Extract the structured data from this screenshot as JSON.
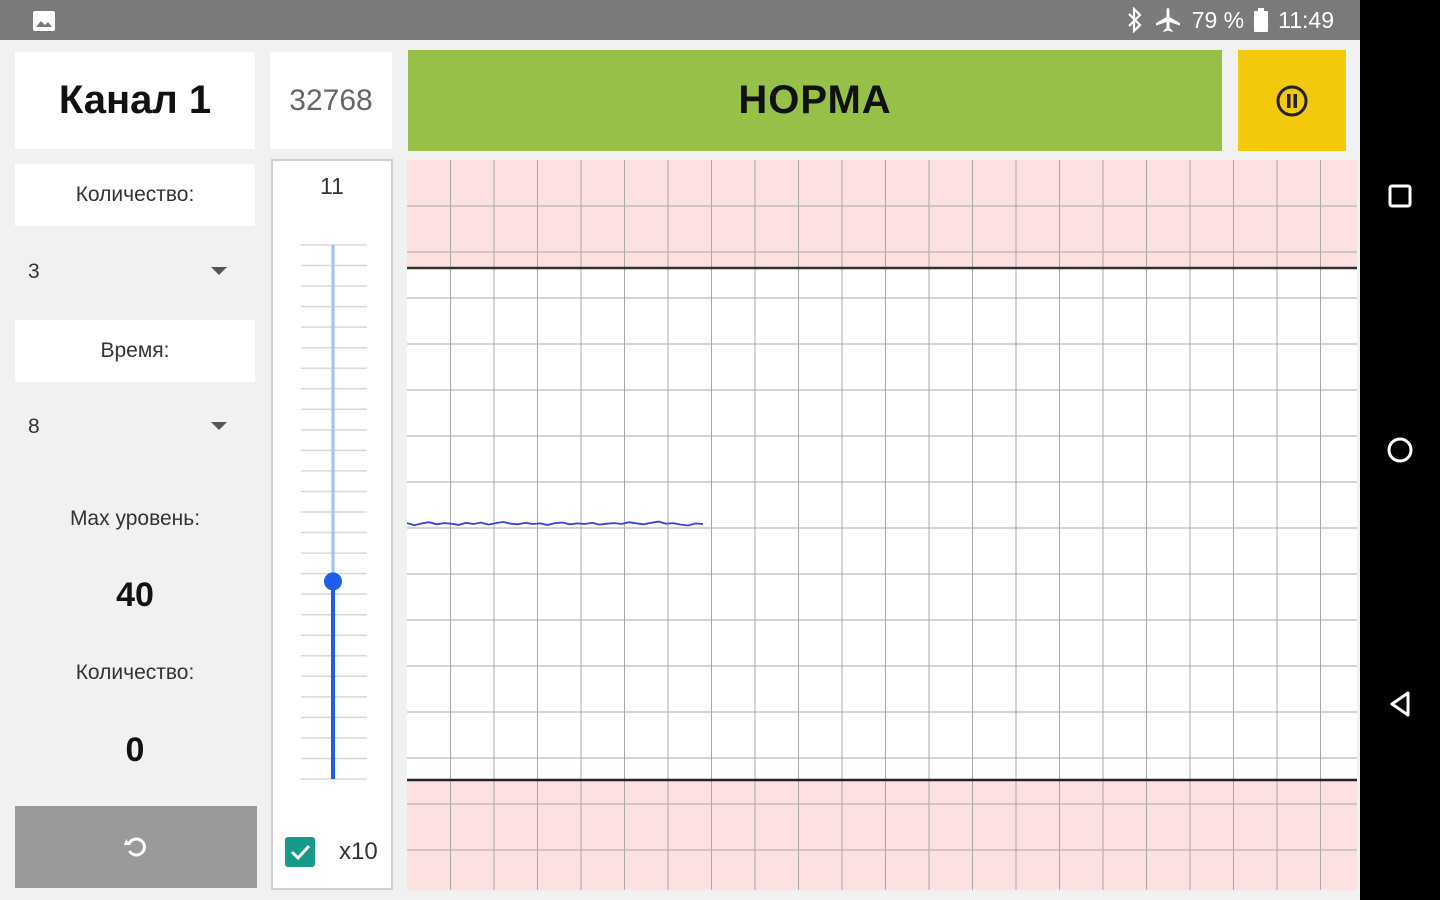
{
  "status_bar": {
    "battery_text": "79 %",
    "time": "11:49",
    "icons": [
      "image-icon",
      "bluetooth-icon",
      "airplane-icon",
      "battery-icon"
    ]
  },
  "channel": {
    "title": "Канал 1",
    "raw_value": "32768"
  },
  "settings": {
    "count_label": "Количество:",
    "count_value": "3",
    "time_label": "Время:",
    "time_value": "8",
    "max_level_label": "Max уровень:",
    "max_level_value": "40",
    "count2_label": "Количество:",
    "count2_value": "0",
    "reset_icon": "reset-icon"
  },
  "slider": {
    "top_value": "11",
    "level_fraction": 0.37,
    "multiplier_label": "x10",
    "multiplier_checked": true
  },
  "status": {
    "label": "НОРМА",
    "color": "#96c047",
    "pause_color": "#f2c90d",
    "pause_icon": "pause-icon"
  },
  "chart_data": {
    "type": "line",
    "alarm_zone_color": "#fde0e0",
    "grid": true,
    "series": [
      {
        "color": "#3344dd",
        "x": [
          0,
          1,
          2,
          3,
          4,
          5,
          6,
          7,
          8,
          9,
          10,
          11,
          12,
          13,
          14,
          15,
          16,
          17,
          18,
          19,
          20,
          21,
          22,
          23,
          24,
          25,
          26,
          27,
          28,
          29,
          30,
          31,
          32,
          33,
          34,
          35,
          36,
          37,
          38,
          39,
          40
        ],
        "y": [
          0.3,
          -0.4,
          0.2,
          0.6,
          -0.1,
          0.3,
          0.1,
          -0.3,
          0.4,
          0.0,
          0.5,
          -0.2,
          0.3,
          0.7,
          0.1,
          -0.1,
          0.4,
          0.0,
          0.2,
          -0.3,
          0.3,
          0.5,
          -0.1,
          0.2,
          0.0,
          0.4,
          -0.2,
          0.1,
          0.3,
          0.0,
          0.6,
          0.2,
          -0.1,
          0.4,
          0.8,
          0.1,
          0.3,
          -0.2,
          -0.5,
          0.2,
          0.0
        ]
      }
    ]
  },
  "nav_bar": {
    "icons": [
      "recents-icon",
      "home-icon",
      "back-icon"
    ]
  }
}
